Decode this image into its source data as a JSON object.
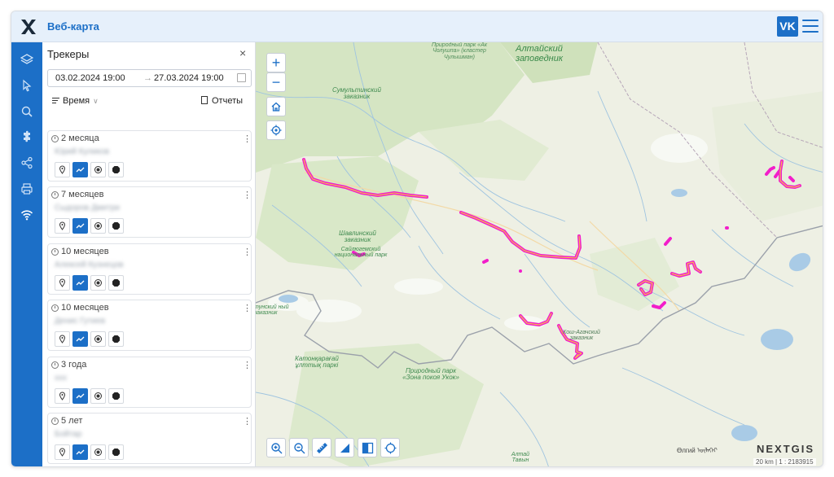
{
  "header": {
    "title": "Веб-карта",
    "user_badge": "VK",
    "accent": "#1c6fc7"
  },
  "rail": {
    "icons": [
      "layers-icon",
      "cursor-icon",
      "search-icon",
      "puzzle-icon",
      "share-icon",
      "print-icon",
      "wifi-icon"
    ]
  },
  "panel": {
    "title": "Трекеры",
    "close": "×",
    "date_from": "03.02.2024 19:00",
    "date_arrow": "→",
    "date_to": "27.03.2024 19:00",
    "sort_label": "Время",
    "reports_label": "Отчеты",
    "trackers": [
      {
        "age": "2 месяца",
        "name": "Юрий Куликов"
      },
      {
        "age": "7 месяцев",
        "name": "Сыдоров Дмитри"
      },
      {
        "age": "10 месяцев",
        "name": "Алексей Кузнецов"
      },
      {
        "age": "10 месяцев",
        "name": "Денис Гутиев"
      },
      {
        "age": "3 года",
        "name": "ххх"
      },
      {
        "age": "5 лет",
        "name": "Бойтар"
      }
    ],
    "kebab": "⋮"
  },
  "map": {
    "labels": [
      {
        "text": "Алтайский заповедник"
      },
      {
        "text": "Природный парк «Ак Чолушпа» (кластер Чулышман)"
      },
      {
        "text": "Сумультинский заказник"
      },
      {
        "text": "Шавлинский заказник"
      },
      {
        "text": "Сайлюгемский национальный парк"
      },
      {
        "text": "Кош-Агачский заказник"
      },
      {
        "text": "Катонқарағай ұлттық паркі"
      },
      {
        "text": "Природный парк «Зона покоя Укок»"
      },
      {
        "text": "тунский ный заказник"
      },
      {
        "text": "Алтай Тавын"
      }
    ],
    "place_bottom": "Өлгий ᠥᠯᠡᠭᠡᠢ",
    "brand": "NEXTGIS",
    "scale": "20 km   |   1 : 2183915",
    "zoom_in": "+",
    "zoom_out": "−",
    "track_color": "#e91ec8"
  }
}
